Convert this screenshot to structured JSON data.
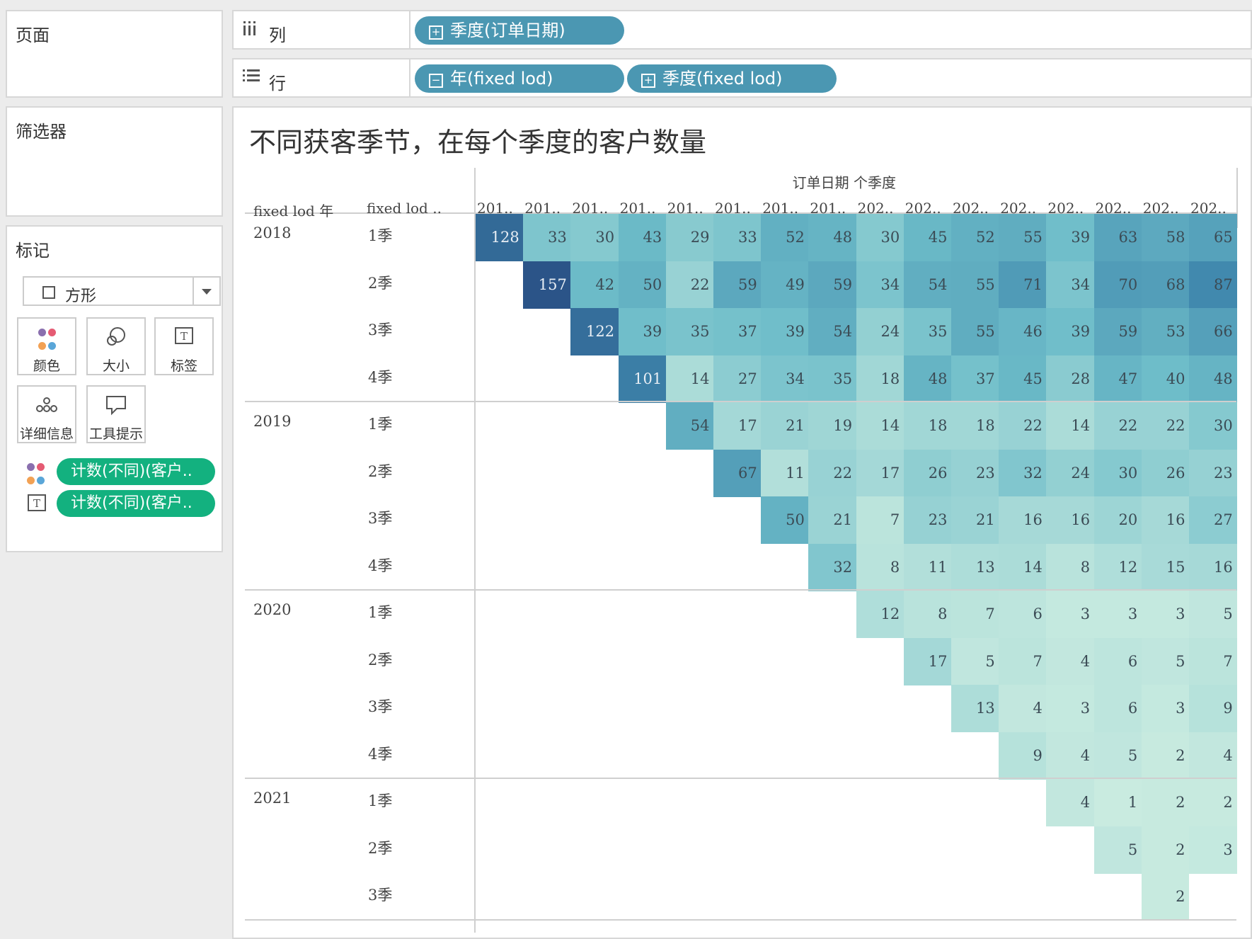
{
  "pages_panel": {
    "title": "页面"
  },
  "filters_panel": {
    "title": "筛选器"
  },
  "marks_panel": {
    "title": "标记",
    "mark_type": "方形",
    "cards": {
      "color": "颜色",
      "size": "大小",
      "label": "标签",
      "detail": "详细信息",
      "tooltip": "工具提示"
    },
    "fields": [
      "计数(不同)(客户..",
      "计数(不同)(客户.."
    ]
  },
  "columns_shelf": {
    "label": "列",
    "pills": [
      "季度(订单日期)"
    ]
  },
  "rows_shelf": {
    "label": "行",
    "pills": [
      "年(fixed lod)",
      "季度(fixed lod)"
    ]
  },
  "viz": {
    "title": "不同获客季节，在每个季度的客户数量",
    "col_group_header": "订单日期 个季度",
    "row_header_1": "fixed lod 年",
    "row_header_2": "fixed lod ..",
    "column_labels": [
      "201..",
      "201..",
      "201..",
      "201..",
      "201..",
      "201..",
      "201..",
      "201..",
      "202..",
      "202..",
      "202..",
      "202..",
      "202..",
      "202..",
      "202..",
      "202.."
    ],
    "years": [
      "2018",
      "2019",
      "2020",
      "2021"
    ],
    "quarters": [
      [
        "1季",
        "2季",
        "3季",
        "4季"
      ],
      [
        "1季",
        "2季",
        "3季",
        "4季"
      ],
      [
        "1季",
        "2季",
        "3季",
        "4季"
      ],
      [
        "1季",
        "2季",
        "3季"
      ]
    ]
  },
  "colors": {
    "min": "#c9ebe0",
    "mid": "#62b4c6",
    "max": "#2a5286"
  },
  "chart_data": {
    "type": "heatmap",
    "title": "不同获客季节，在每个季度的客户数量",
    "col_label": "订单日期 个季度",
    "row_labels": [
      "2018 1季",
      "2018 2季",
      "2018 3季",
      "2018 4季",
      "2019 1季",
      "2019 2季",
      "2019 3季",
      "2019 4季",
      "2020 1季",
      "2020 2季",
      "2020 3季",
      "2020 4季",
      "2021 1季",
      "2021 2季",
      "2021 3季"
    ],
    "values": [
      [
        128,
        33,
        30,
        43,
        29,
        33,
        52,
        48,
        30,
        45,
        52,
        55,
        39,
        63,
        58,
        65
      ],
      [
        null,
        157,
        42,
        50,
        22,
        59,
        49,
        59,
        34,
        54,
        55,
        71,
        34,
        70,
        68,
        87
      ],
      [
        null,
        null,
        122,
        39,
        35,
        37,
        39,
        54,
        24,
        35,
        55,
        46,
        39,
        59,
        53,
        66
      ],
      [
        null,
        null,
        null,
        101,
        14,
        27,
        34,
        35,
        18,
        48,
        37,
        45,
        28,
        47,
        40,
        48
      ],
      [
        null,
        null,
        null,
        null,
        54,
        17,
        21,
        19,
        14,
        18,
        18,
        22,
        14,
        22,
        22,
        30
      ],
      [
        null,
        null,
        null,
        null,
        null,
        67,
        11,
        22,
        17,
        26,
        23,
        32,
        24,
        30,
        26,
        23
      ],
      [
        null,
        null,
        null,
        null,
        null,
        null,
        50,
        21,
        7,
        23,
        21,
        16,
        16,
        20,
        16,
        27
      ],
      [
        null,
        null,
        null,
        null,
        null,
        null,
        null,
        32,
        8,
        11,
        13,
        14,
        8,
        12,
        15,
        16
      ],
      [
        null,
        null,
        null,
        null,
        null,
        null,
        null,
        null,
        12,
        8,
        7,
        6,
        3,
        3,
        3,
        5
      ],
      [
        null,
        null,
        null,
        null,
        null,
        null,
        null,
        null,
        null,
        17,
        5,
        7,
        4,
        6,
        5,
        7
      ],
      [
        null,
        null,
        null,
        null,
        null,
        null,
        null,
        null,
        null,
        null,
        13,
        4,
        3,
        6,
        3,
        9
      ],
      [
        null,
        null,
        null,
        null,
        null,
        null,
        null,
        null,
        null,
        null,
        null,
        9,
        4,
        5,
        2,
        4
      ],
      [
        null,
        null,
        null,
        null,
        null,
        null,
        null,
        null,
        null,
        null,
        null,
        null,
        4,
        1,
        2,
        2
      ],
      [
        null,
        null,
        null,
        null,
        null,
        null,
        null,
        null,
        null,
        null,
        null,
        null,
        null,
        5,
        2,
        3
      ],
      [
        null,
        null,
        null,
        null,
        null,
        null,
        null,
        null,
        null,
        null,
        null,
        null,
        null,
        null,
        2,
        null
      ]
    ]
  }
}
